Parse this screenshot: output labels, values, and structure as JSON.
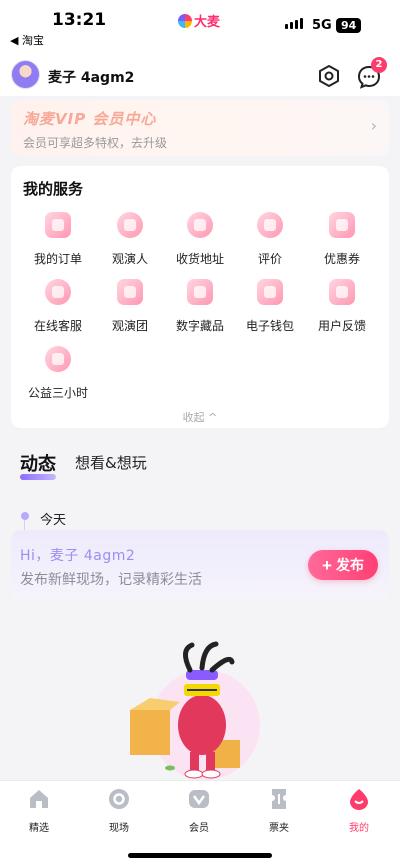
{
  "status_bar": {
    "time": "13:21",
    "back_app": "◀ 淘宝",
    "brand": "大麦",
    "network": "5G",
    "battery": "94"
  },
  "profile": {
    "username": "麦子 4agm2",
    "message_badge": "2"
  },
  "vip": {
    "title": "淘麦VIP 会员中心",
    "subtitle": "会员可享超多特权，去升级"
  },
  "services": {
    "title": "我的服务",
    "items": [
      {
        "label": "我的订单",
        "icon": "order-icon"
      },
      {
        "label": "观演人",
        "icon": "viewer-icon"
      },
      {
        "label": "收货地址",
        "icon": "address-icon"
      },
      {
        "label": "评价",
        "icon": "review-icon"
      },
      {
        "label": "优惠券",
        "icon": "coupon-icon"
      },
      {
        "label": "在线客服",
        "icon": "customer-service-icon"
      },
      {
        "label": "观演团",
        "icon": "viewing-group-icon"
      },
      {
        "label": "数字藏品",
        "icon": "digital-collectible-icon"
      },
      {
        "label": "电子钱包",
        "icon": "wallet-icon"
      },
      {
        "label": "用户反馈",
        "icon": "feedback-icon"
      },
      {
        "label": "公益三小时",
        "icon": "charity-heart-icon"
      }
    ],
    "collapse_label": "收起 ^"
  },
  "tabs": {
    "active": "动态",
    "other": "想看&想玩"
  },
  "timeline": {
    "label": "今天"
  },
  "post": {
    "greeting": "Hi，麦子 4agm2",
    "subtitle": "发布新鲜现场，记录精彩生活",
    "button_label": "发布"
  },
  "bottom_nav": [
    {
      "label": "精选",
      "icon": "home-icon"
    },
    {
      "label": "现场",
      "icon": "live-icon"
    },
    {
      "label": "会员",
      "icon": "vip-icon"
    },
    {
      "label": "票夹",
      "icon": "ticket-icon"
    },
    {
      "label": "我的",
      "icon": "profile-icon"
    }
  ],
  "colors": {
    "accent": "#ff3b6b",
    "purple": "#8a6dff"
  }
}
